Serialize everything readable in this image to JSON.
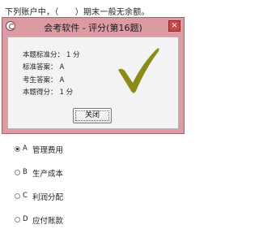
{
  "question": {
    "text": "下列账户中，（　　）期末一般无余额。"
  },
  "dialog": {
    "title": "会考软件 - 评分(第16题)",
    "close_glyph": "×",
    "rows": [
      {
        "label": "本题标准分：",
        "value": "1 分"
      },
      {
        "label": "标准答案：",
        "value": "A"
      },
      {
        "label": "考生答案：",
        "value": "A"
      },
      {
        "label": "本题得分：",
        "value": "1 分"
      }
    ],
    "checkmark_color": "#8b8b1a",
    "close_button_label": "关闭"
  },
  "options": [
    {
      "letter": "A",
      "text": "管理费用",
      "selected": true
    },
    {
      "letter": "B",
      "text": "生产成本",
      "selected": false
    },
    {
      "letter": "C",
      "text": "利润分配",
      "selected": false
    },
    {
      "letter": "D",
      "text": "应付账款",
      "selected": false
    }
  ],
  "colors": {
    "dialog_frame": "#dc9aa3",
    "close_button": "#c64848",
    "client_background": "#f3f3f3"
  }
}
